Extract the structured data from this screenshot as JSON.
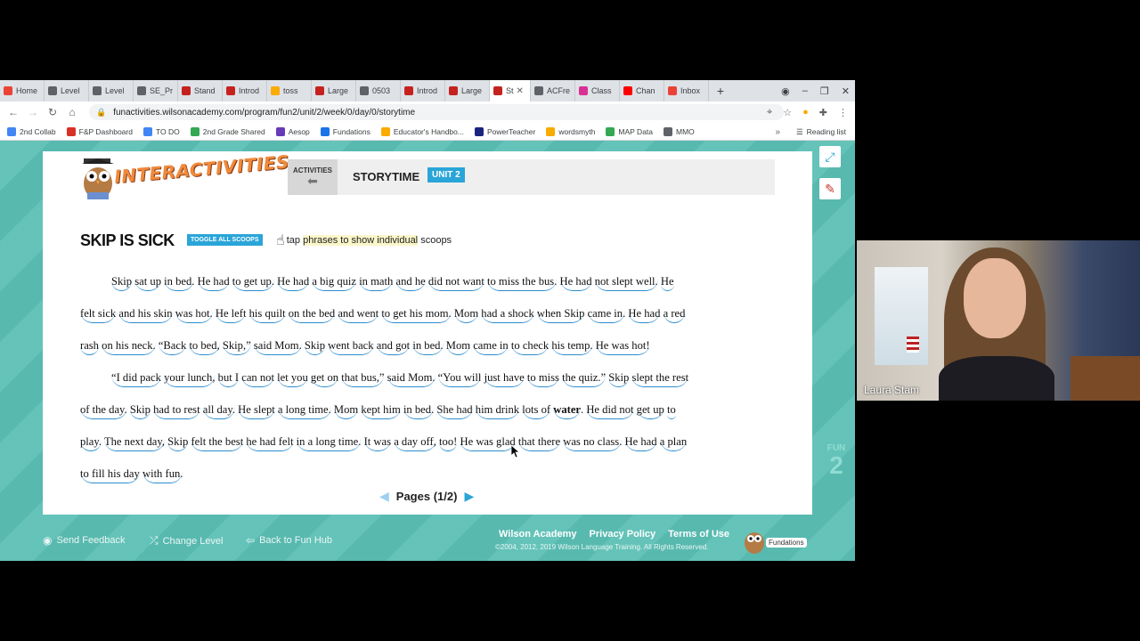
{
  "tabs": [
    {
      "label": "Home",
      "color": "#ea4335"
    },
    {
      "label": "Level",
      "color": "#5f6368"
    },
    {
      "label": "Level",
      "color": "#5f6368"
    },
    {
      "label": "SE_Pr",
      "color": "#5f6368"
    },
    {
      "label": "Stand",
      "color": "#c5221f"
    },
    {
      "label": "Introd",
      "color": "#c5221f"
    },
    {
      "label": "toss",
      "color": "#f9ab00"
    },
    {
      "label": "Large",
      "color": "#c5221f"
    },
    {
      "label": "0503",
      "color": "#5f6368"
    },
    {
      "label": "Introd",
      "color": "#c5221f"
    },
    {
      "label": "Large",
      "color": "#c5221f"
    },
    {
      "label": "St",
      "color": "#c5221f",
      "active": true
    },
    {
      "label": "ACFre",
      "color": "#5f6368"
    },
    {
      "label": "Class",
      "color": "#d93096"
    },
    {
      "label": "Chan",
      "color": "#ff0000"
    },
    {
      "label": "Inbox",
      "color": "#ea4335"
    }
  ],
  "new_tab": "+",
  "window_controls": {
    "minimize": "–",
    "restore": "❐",
    "close": "✕"
  },
  "address": {
    "url": "funactivities.wilsonacademy.com/program/fun2/unit/2/week/0/day/0/storytime"
  },
  "bookmarks": [
    {
      "label": "2nd Collab",
      "color": "#4285f4"
    },
    {
      "label": "F&P Dashboard",
      "color": "#d93025"
    },
    {
      "label": "TO DO",
      "color": "#4285f4"
    },
    {
      "label": "2nd Grade Shared",
      "color": "#34a853"
    },
    {
      "label": "Aesop",
      "color": "#673ab7"
    },
    {
      "label": "Fundations",
      "color": "#1a73e8"
    },
    {
      "label": "Educator's Handbo...",
      "color": "#f9ab00"
    },
    {
      "label": "PowerTeacher",
      "color": "#1a237e"
    },
    {
      "label": "wordsmyth",
      "color": "#f9ab00"
    },
    {
      "label": "MAP Data",
      "color": "#34a853"
    },
    {
      "label": "MMO",
      "color": "#5f6368"
    }
  ],
  "bookmarks_more": "»",
  "reading_list": "Reading list",
  "app": {
    "logo_text": "INTERACTIVITIES",
    "activities_label": "ACTIVITIES",
    "activity_name": "STORYTIME",
    "unit_badge": "UNIT 2",
    "story_title": "SKIP IS SICK",
    "toggle_label": "TOGGLE ALL SCOOPS",
    "tap_prefix": "tap",
    "tap_highlight": "phrases to show individual",
    "tap_suffix": "scoops",
    "pager_label": "Pages (1/2)",
    "fun_label": "FUN",
    "fun_number": "2"
  },
  "story": {
    "lines": [
      {
        "indent": true,
        "phrases": [
          "Skip",
          "sat up",
          "in bed.",
          "He had",
          "to get up.",
          "He had",
          "a big quiz",
          "in math",
          "and he",
          "did not want",
          "to miss the bus.",
          "He had",
          "not slept well.",
          "He"
        ]
      },
      {
        "indent": false,
        "phrases": [
          "felt sick",
          "and his skin",
          "was hot.",
          "He left",
          "his quilt",
          "on the bed",
          "and went",
          "to get his mom.",
          "Mom",
          "had a shock",
          "when Skip",
          "came in.",
          "He had",
          "a red"
        ]
      },
      {
        "indent": false,
        "phrases": [
          "rash",
          "on his neck.",
          "“Back",
          "to bed,",
          "Skip,”",
          "said Mom.",
          "Skip",
          "went back",
          "and got",
          "in bed.",
          "Mom",
          "came in",
          "to check",
          "his temp.",
          "He was hot!"
        ]
      },
      {
        "indent": true,
        "phrases": [
          "“I did pack",
          "your lunch,",
          "but I",
          "can not",
          "let you",
          "get on",
          "that bus,”",
          "said Mom.",
          "“You will",
          "just have",
          "to miss",
          "the quiz.”",
          "Skip",
          "slept the rest"
        ]
      },
      {
        "indent": false,
        "phrases": [
          "of the day.",
          "Skip",
          "had to rest",
          "all day.",
          "He slept",
          "a long time.",
          "Mom",
          "kept him",
          "in bed.",
          "She had",
          "him drink",
          "lots of",
          "{b}water",
          ".",
          "He did not",
          "get up",
          "to"
        ]
      },
      {
        "indent": false,
        "phrases": [
          "play.",
          "The next day,",
          "Skip",
          "felt the best",
          "he had felt",
          "in a long time.",
          "It was",
          "a day off,",
          "too!",
          "He was glad",
          "that there",
          "was no class.",
          "He had",
          "a plan"
        ]
      },
      {
        "indent": false,
        "phrases": [
          "to fill his day",
          "with fun."
        ]
      }
    ]
  },
  "footer": {
    "send_feedback": "Send Feedback",
    "change_level": "Change Level",
    "back_to_hub": "Back to Fun Hub",
    "wilson_academy": "Wilson Academy",
    "privacy": "Privacy Policy",
    "terms": "Terms of Use",
    "copyright": "©2004, 2012, 2019 Wilson Language Training. All Rights Reserved.",
    "fundations_mark": "Fundations"
  },
  "webcam": {
    "name": "Laura Stam"
  }
}
